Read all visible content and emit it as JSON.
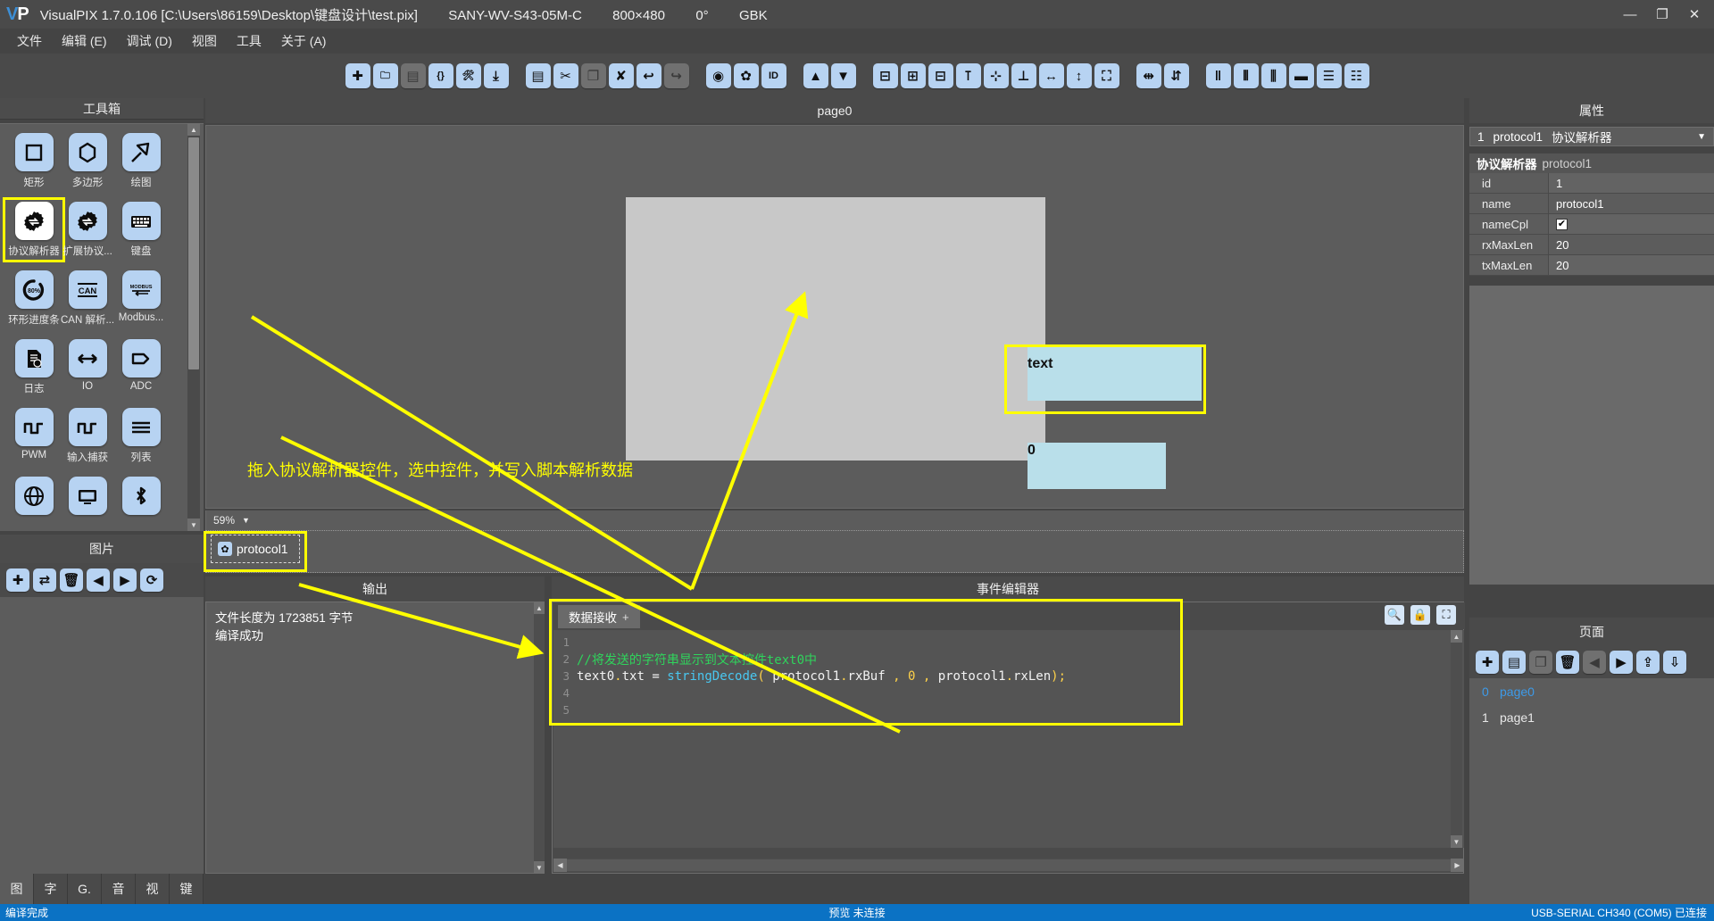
{
  "window": {
    "logo": "VP",
    "title": "VisualPIX 1.7.0.106 [C:\\Users\\86159\\Desktop\\键盘设计\\test.pix]",
    "device": "SANY-WV-S43-05M-C",
    "resolution": "800×480",
    "rotation": "0°",
    "encoding": "GBK",
    "minimize": "—",
    "restore": "❐",
    "close": "✕"
  },
  "menu": {
    "items": [
      {
        "label": "文件",
        "name": "menu-file"
      },
      {
        "label": "编辑 (E)",
        "name": "menu-edit"
      },
      {
        "label": "调试 (D)",
        "name": "menu-debug"
      },
      {
        "label": "视图",
        "name": "menu-view"
      },
      {
        "label": "工具",
        "name": "menu-tools"
      },
      {
        "label": "关于 (A)",
        "name": "menu-about"
      }
    ]
  },
  "toolbar": {
    "groups": [
      [
        {
          "icon": "new-file-icon",
          "glyph": "✚",
          "disabled": false
        },
        {
          "icon": "open-folder-icon",
          "glyph": "🗀",
          "disabled": false
        },
        {
          "icon": "save-icon",
          "glyph": "▤",
          "disabled": true
        },
        {
          "icon": "braces-icon",
          "glyph": "{}",
          "disabled": false
        },
        {
          "icon": "build-tools-icon",
          "glyph": "🛠",
          "disabled": false
        },
        {
          "icon": "download-icon",
          "glyph": "⤓",
          "disabled": false
        }
      ],
      [
        {
          "icon": "copy-page-icon",
          "glyph": "▤",
          "disabled": false
        },
        {
          "icon": "cut-icon",
          "glyph": "✂",
          "disabled": false
        },
        {
          "icon": "paste-icon",
          "glyph": "❐",
          "disabled": true
        },
        {
          "icon": "delete-icon",
          "glyph": "✘",
          "disabled": false
        },
        {
          "icon": "undo-icon",
          "glyph": "↩",
          "disabled": false
        },
        {
          "icon": "redo-icon",
          "glyph": "↪",
          "disabled": true
        }
      ],
      [
        {
          "icon": "preview-eye-icon",
          "glyph": "◉",
          "disabled": false
        },
        {
          "icon": "settings-gear-icon",
          "glyph": "✿",
          "disabled": false
        },
        {
          "icon": "id-icon",
          "glyph": "ID",
          "disabled": false
        }
      ],
      [
        {
          "icon": "move-up-icon",
          "glyph": "▲",
          "disabled": false
        },
        {
          "icon": "move-down-icon",
          "glyph": "▼",
          "disabled": false
        }
      ],
      [
        {
          "icon": "align-top-icon",
          "glyph": "⊟",
          "disabled": false
        },
        {
          "icon": "align-middle-icon",
          "glyph": "⊞",
          "disabled": false
        },
        {
          "icon": "align-bottom-icon",
          "glyph": "⊟",
          "disabled": false
        },
        {
          "icon": "align-left-icon",
          "glyph": "⊺",
          "disabled": false
        },
        {
          "icon": "align-center-icon",
          "glyph": "⊹",
          "disabled": false
        },
        {
          "icon": "align-right-icon",
          "glyph": "⊥",
          "disabled": false
        },
        {
          "icon": "same-width-icon",
          "glyph": "↔",
          "disabled": false
        },
        {
          "icon": "same-height-icon",
          "glyph": "↕",
          "disabled": false
        },
        {
          "icon": "same-size-icon",
          "glyph": "⛶",
          "disabled": false
        }
      ],
      [
        {
          "icon": "center-horizontal-icon",
          "glyph": "⇹",
          "disabled": false
        },
        {
          "icon": "center-vertical-icon",
          "glyph": "⇵",
          "disabled": false
        }
      ],
      [
        {
          "icon": "distribute-h-icon",
          "glyph": "‖",
          "disabled": false
        },
        {
          "icon": "spacing-h-icon",
          "glyph": "⫴",
          "disabled": false
        },
        {
          "icon": "spacing-v-icon",
          "glyph": "⫼",
          "disabled": false
        },
        {
          "icon": "gap-remove-icon",
          "glyph": "▬",
          "disabled": false
        },
        {
          "icon": "list-order-icon",
          "glyph": "☰",
          "disabled": false
        },
        {
          "icon": "list-indent-icon",
          "glyph": "☷",
          "disabled": false
        }
      ]
    ]
  },
  "toolbox": {
    "title": "工具箱",
    "items": [
      {
        "label": "矩形",
        "icon": "rectangle-icon",
        "selected": false
      },
      {
        "label": "多边形",
        "icon": "polygon-icon",
        "selected": false
      },
      {
        "label": "绘图",
        "icon": "draw-pen-icon",
        "selected": false
      },
      {
        "label": "协议解析器",
        "icon": "protocol-parser-icon",
        "selected": true
      },
      {
        "label": "扩展协议...",
        "icon": "extended-protocol-icon",
        "selected": false
      },
      {
        "label": "键盘",
        "icon": "keyboard-icon",
        "selected": false
      },
      {
        "label": "环形进度条",
        "icon": "circular-progress-icon",
        "selected": false
      },
      {
        "label": "CAN 解析...",
        "icon": "can-parser-icon",
        "selected": false
      },
      {
        "label": "Modbus...",
        "icon": "modbus-icon",
        "selected": false
      },
      {
        "label": "日志",
        "icon": "log-icon",
        "selected": false
      },
      {
        "label": "IO",
        "icon": "io-arrow-icon",
        "selected": false
      },
      {
        "label": "ADC",
        "icon": "adc-icon",
        "selected": false
      },
      {
        "label": "PWM",
        "icon": "pwm-icon",
        "selected": false
      },
      {
        "label": "输入捕获",
        "icon": "input-capture-icon",
        "selected": false
      },
      {
        "label": "列表",
        "icon": "list-icon",
        "selected": false
      },
      {
        "label": "",
        "icon": "globe-icon",
        "selected": false
      },
      {
        "label": "",
        "icon": "screen-icon",
        "selected": false
      },
      {
        "label": "",
        "icon": "bluetooth-icon",
        "selected": false
      }
    ]
  },
  "images_panel": {
    "title": "图片",
    "tools": [
      {
        "icon": "add-image-icon",
        "glyph": "✚",
        "disabled": false
      },
      {
        "icon": "replace-image-icon",
        "glyph": "⇄",
        "disabled": false
      },
      {
        "icon": "delete-image-icon",
        "glyph": "🗑",
        "disabled": false
      },
      {
        "icon": "prev-image-icon",
        "glyph": "◀",
        "disabled": false
      },
      {
        "icon": "next-image-icon",
        "glyph": "▶",
        "disabled": false
      },
      {
        "icon": "refresh-image-icon",
        "glyph": "⟳",
        "disabled": false
      }
    ],
    "tabs": [
      {
        "label": "图",
        "name": "tab-image",
        "active": true
      },
      {
        "label": "字",
        "name": "tab-font",
        "active": false
      },
      {
        "label": "G.",
        "name": "tab-gif",
        "active": false
      },
      {
        "label": "音",
        "name": "tab-audio",
        "active": false
      },
      {
        "label": "视",
        "name": "tab-video",
        "active": false
      },
      {
        "label": "键",
        "name": "tab-key",
        "active": false
      }
    ]
  },
  "canvas": {
    "page_title": "page0",
    "zoom": "59%",
    "widgets": [
      {
        "name": "text0-widget",
        "label": "text"
      },
      {
        "name": "number-widget",
        "label": "0"
      }
    ],
    "annotation": "拖入协议解析器控件，选中控件，并写入脚本解析数据",
    "object_chip": "protocol1"
  },
  "output": {
    "title": "输出",
    "lines": [
      "文件长度为 1723851 字节",
      "编译成功"
    ]
  },
  "event_editor": {
    "title": "事件编辑器",
    "tab": "数据接收",
    "tab_add": "+",
    "icons": [
      {
        "icon": "search-icon",
        "glyph": "🔍",
        "name": "search-code-button"
      },
      {
        "icon": "lock-icon",
        "glyph": "🔒",
        "name": "lock-code-button"
      },
      {
        "icon": "fullscreen-icon",
        "glyph": "⛶",
        "name": "fullscreen-code-button"
      }
    ],
    "code_lines": [
      {
        "n": "1",
        "tokens": []
      },
      {
        "n": "2",
        "tokens": [
          {
            "t": "//将发送的字符串显示到文本控件text0中",
            "c": "c-com"
          }
        ]
      },
      {
        "n": "3",
        "tokens": [
          {
            "t": "text0",
            "c": "c-id"
          },
          {
            "t": ".",
            "c": "c-pun"
          },
          {
            "t": "txt",
            "c": "c-id"
          },
          {
            "t": " = ",
            "c": "c-op"
          },
          {
            "t": "stringDecode",
            "c": "c-fn"
          },
          {
            "t": "(",
            "c": "c-pun"
          },
          {
            "t": " protocol1",
            "c": "c-id"
          },
          {
            "t": ".",
            "c": "c-pun"
          },
          {
            "t": "rxBuf",
            "c": "c-id"
          },
          {
            "t": " , ",
            "c": "c-pun"
          },
          {
            "t": "0",
            "c": "c-num"
          },
          {
            "t": " , ",
            "c": "c-pun"
          },
          {
            "t": "protocol1",
            "c": "c-id"
          },
          {
            "t": ".",
            "c": "c-pun"
          },
          {
            "t": "rxLen",
            "c": "c-id"
          },
          {
            "t": ")",
            "c": "c-pun"
          },
          {
            "t": ";",
            "c": "c-pun"
          }
        ]
      },
      {
        "n": "4",
        "tokens": []
      },
      {
        "n": "5",
        "tokens": []
      }
    ]
  },
  "properties": {
    "title": "属性",
    "combo": {
      "index": "1",
      "name": "protocol1",
      "type": "协议解析器"
    },
    "group": {
      "type": "协议解析器",
      "name": "protocol1"
    },
    "rows": [
      {
        "key": "id",
        "value": "1",
        "kind": "text"
      },
      {
        "key": "name",
        "value": "protocol1",
        "kind": "text"
      },
      {
        "key": "nameCpl",
        "value": "✔",
        "kind": "checkbox"
      },
      {
        "key": "rxMaxLen",
        "value": "20",
        "kind": "text"
      },
      {
        "key": "txMaxLen",
        "value": "20",
        "kind": "text"
      }
    ]
  },
  "pages": {
    "title": "页面",
    "tools": [
      {
        "icon": "add-page-icon",
        "glyph": "✚",
        "disabled": false
      },
      {
        "icon": "copy-page-icon",
        "glyph": "▤",
        "disabled": false
      },
      {
        "icon": "paste-page-icon",
        "glyph": "❐",
        "disabled": true
      },
      {
        "icon": "delete-page-icon",
        "glyph": "🗑",
        "disabled": false
      },
      {
        "icon": "prev-page-icon",
        "glyph": "◀",
        "disabled": true
      },
      {
        "icon": "next-page-icon",
        "glyph": "▶",
        "disabled": false
      },
      {
        "icon": "import-page-icon",
        "glyph": "⇪",
        "disabled": false
      },
      {
        "icon": "export-page-icon",
        "glyph": "⇩",
        "disabled": false
      }
    ],
    "items": [
      {
        "index": "0",
        "label": "page0",
        "selected": true
      },
      {
        "index": "1",
        "label": "page1",
        "selected": false
      }
    ]
  },
  "statusbar": {
    "left": "编译完成",
    "center": "预览 未连接",
    "right": "USB-SERIAL CH340 (COM5) 已连接"
  },
  "colors": {
    "accent_blue": "#0b72c4",
    "highlight_yellow": "#ffff00",
    "icon_blue": "#b7d3f2",
    "widget_cyan": "#b9dfea",
    "code_comment_green": "#2fd45c"
  }
}
